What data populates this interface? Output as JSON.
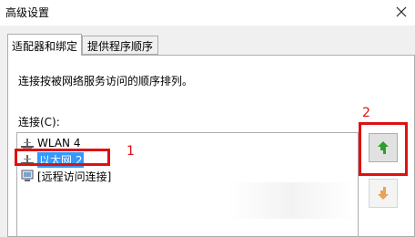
{
  "window": {
    "title": "高级设置"
  },
  "tabs": [
    {
      "label": "适配器和绑定",
      "active": true
    },
    {
      "label": "提供程序顺序",
      "active": false
    }
  ],
  "panel": {
    "description": "连接按被网络服务访问的顺序排列。",
    "connections_label": "连接(C):",
    "connections": [
      {
        "label": "WLAN 4",
        "icon": "network-adapter-icon",
        "selected": false
      },
      {
        "label": "以太网 2",
        "icon": "network-adapter-icon",
        "selected": true
      },
      {
        "label": "[远程访问连接]",
        "icon": "remote-access-icon",
        "selected": false
      }
    ]
  },
  "annotations": {
    "label_1": "1",
    "label_2": "2",
    "color": "#e01010"
  },
  "buttons": {
    "move_up": {
      "icon": "green-up-arrow-icon",
      "color": "#2e9e2e",
      "enabled": true
    },
    "move_down": {
      "icon": "orange-down-arrow-icon",
      "color": "#e8a25a",
      "enabled": false
    }
  },
  "colors": {
    "selection": "#3399ff",
    "window_bg": "#f0f0f0"
  }
}
